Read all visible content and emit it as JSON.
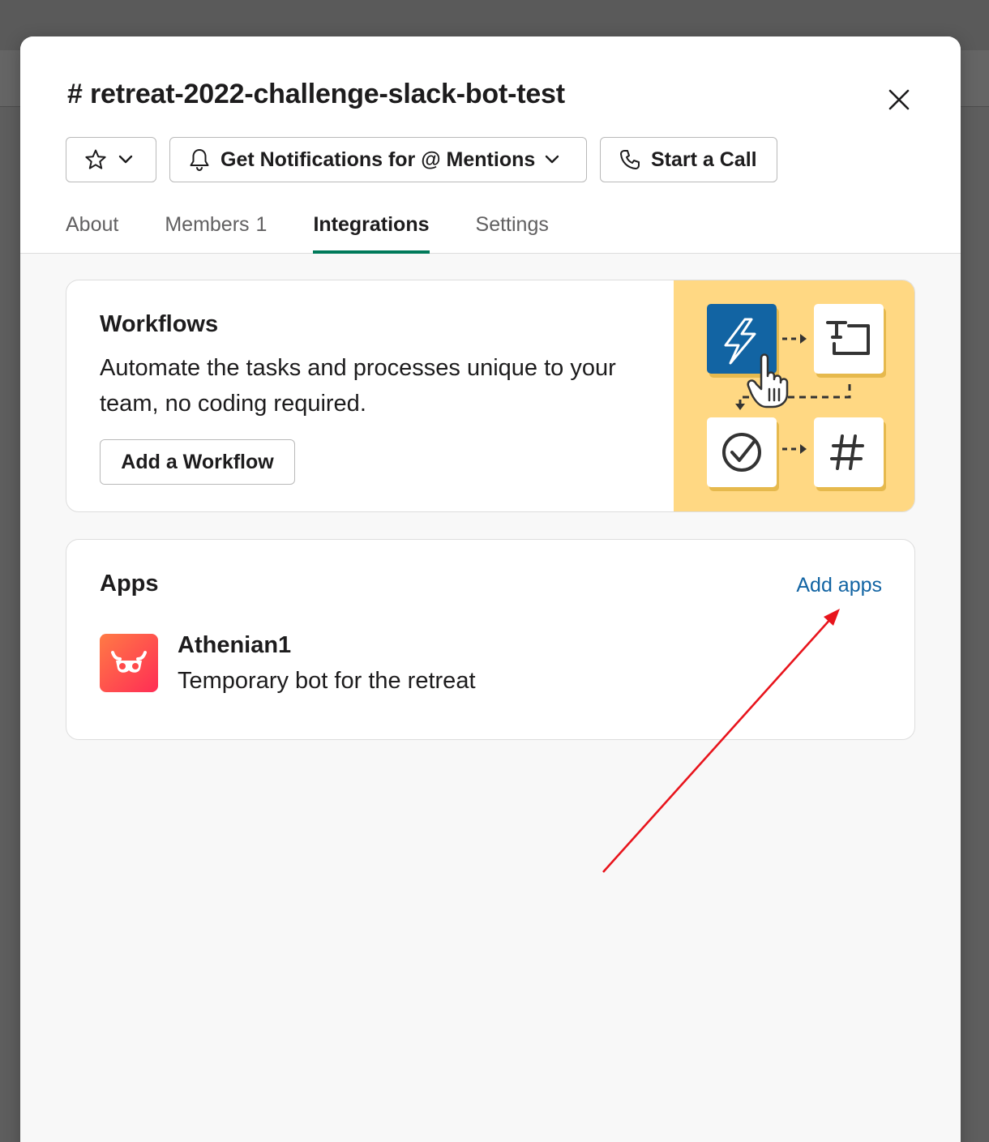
{
  "channel": {
    "title": "# retreat-2022-challenge-slack-bot-test"
  },
  "header_buttons": {
    "star_icon": "star-icon",
    "notify_label": "Get Notifications for @ Mentions",
    "call_label": "Start a Call"
  },
  "tabs": [
    {
      "label": "About"
    },
    {
      "label": "Members",
      "count": "1"
    },
    {
      "label": "Integrations",
      "active": true
    },
    {
      "label": "Settings"
    }
  ],
  "workflows": {
    "title": "Workflows",
    "description": "Automate the tasks and processes unique to your team, no coding required.",
    "button_label": "Add a Workflow"
  },
  "apps": {
    "title": "Apps",
    "add_label": "Add apps",
    "items": [
      {
        "name": "Athenian1",
        "description": "Temporary bot for the retreat",
        "logo": "owl-logo-icon"
      }
    ]
  },
  "colors": {
    "accent": "#007a5a",
    "link": "#1264a3",
    "illustration_bg": "#ffd883",
    "illustration_tile": "#1264a3",
    "annotation_arrow": "#e8141c"
  }
}
